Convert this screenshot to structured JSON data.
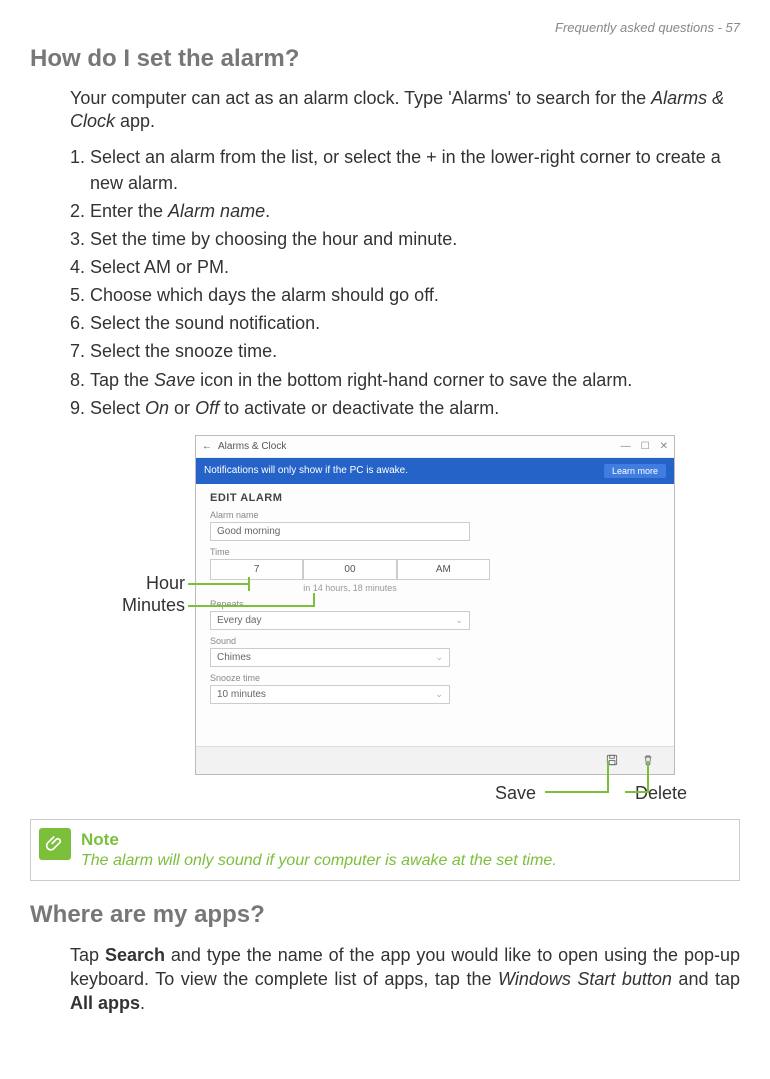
{
  "header": "Frequently asked questions - 57",
  "section1": {
    "title": "How do I set the alarm?",
    "intro_before": "Your computer can act as an alarm clock. Type 'Alarms' to search for the ",
    "intro_em": "Alarms & Clock",
    "intro_after": " app.",
    "steps": [
      {
        "text": "Select an alarm from the list, or select the + in the lower-right corner to create a new alarm."
      },
      {
        "pre": "Enter the ",
        "em": "Alarm name",
        "post": "."
      },
      {
        "text": "Set the time by choosing the hour and minute."
      },
      {
        "text": "Select AM or PM."
      },
      {
        "text": "Choose which days the alarm should go off."
      },
      {
        "text": "Select the sound notification."
      },
      {
        "text": "Select the snooze time."
      },
      {
        "pre": "Tap the ",
        "em": "Save",
        "post": " icon in the bottom right-hand corner to save the alarm."
      },
      {
        "pre": "Select ",
        "em": "On",
        "mid": " or ",
        "em2": "Off",
        "post": " to activate or deactivate the alarm."
      }
    ]
  },
  "app": {
    "title": "Alarms & Clock",
    "banner": "Notifications will only show if the PC is awake.",
    "learn": "Learn more",
    "edit_title": "EDIT ALARM",
    "alarm_name_label": "Alarm name",
    "alarm_name_value": "Good morning",
    "time_label": "Time",
    "hour": "7",
    "minute": "00",
    "ampm": "AM",
    "time_hint": "in 14 hours, 18 minutes",
    "repeats_label": "Repeats",
    "repeats_value": "Every day",
    "sound_label": "Sound",
    "sound_value": "Chimes",
    "snooze_label": "Snooze time",
    "snooze_value": "10 minutes"
  },
  "callouts": {
    "hour": "Hour",
    "minutes": "Minutes",
    "save": "Save",
    "delete": "Delete"
  },
  "note": {
    "title": "Note",
    "text": "The alarm will only sound if your computer is awake at the set time."
  },
  "section2": {
    "title": "Where are my apps?",
    "p_pre": "Tap ",
    "p_b1": "Search",
    "p_mid1": " and type the name of the app you would like to open using the pop-up keyboard. To view the complete list of apps, tap the ",
    "p_em": "Windows Start button",
    "p_mid2": " and tap ",
    "p_b2": "All apps",
    "p_post": "."
  }
}
